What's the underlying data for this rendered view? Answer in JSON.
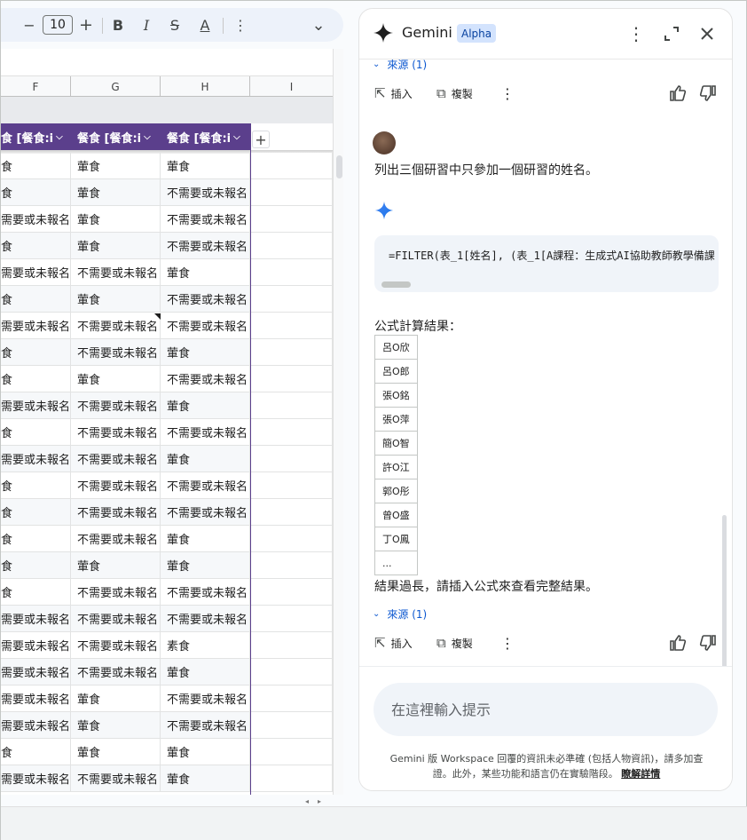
{
  "toolbar": {
    "minus": "−",
    "font_size": "10",
    "plus": "+",
    "bold": "B",
    "italic": "I",
    "strike": "S",
    "text_color": "A",
    "more": "⋮",
    "collapse": "⌄"
  },
  "sheet": {
    "columns": [
      "F",
      "G",
      "H",
      "I"
    ],
    "table_headers": [
      "食 [餐食:i",
      "餐食 [餐食:i",
      "餐食 [餐食:i"
    ],
    "rows": [
      [
        "食",
        "葷食",
        "葷食"
      ],
      [
        "食",
        "葷食",
        "不需要或未報名"
      ],
      [
        "需要或未報名",
        "葷食",
        "不需要或未報名"
      ],
      [
        "食",
        "葷食",
        "不需要或未報名"
      ],
      [
        "需要或未報名",
        "不需要或未報名",
        "葷食"
      ],
      [
        "食",
        "葷食",
        "不需要或未報名"
      ],
      [
        "需要或未報名",
        "不需要或未報名",
        "不需要或未報名"
      ],
      [
        "食",
        "不需要或未報名",
        "葷食"
      ],
      [
        "食",
        "葷食",
        "不需要或未報名"
      ],
      [
        "需要或未報名",
        "不需要或未報名",
        "葷食"
      ],
      [
        "食",
        "不需要或未報名",
        "不需要或未報名"
      ],
      [
        "需要或未報名",
        "不需要或未報名",
        "葷食"
      ],
      [
        "食",
        "不需要或未報名",
        "不需要或未報名"
      ],
      [
        "食",
        "不需要或未報名",
        "不需要或未報名"
      ],
      [
        "食",
        "不需要或未報名",
        "葷食"
      ],
      [
        "食",
        "葷食",
        "葷食"
      ],
      [
        "食",
        "不需要或未報名",
        "不需要或未報名"
      ],
      [
        "需要或未報名",
        "不需要或未報名",
        "不需要或未報名"
      ],
      [
        "需要或未報名",
        "不需要或未報名",
        "素食"
      ],
      [
        "需要或未報名",
        "不需要或未報名",
        "葷食"
      ],
      [
        "需要或未報名",
        "葷食",
        "不需要或未報名"
      ],
      [
        "需要或未報名",
        "葷食",
        "不需要或未報名"
      ],
      [
        "食",
        "葷食",
        "葷食"
      ],
      [
        "需要或未報名",
        "不需要或未報名",
        "葷食"
      ]
    ]
  },
  "gemini": {
    "title": "Gemini",
    "badge": "Alpha",
    "sources_label": "來源 (1)",
    "insert_label": "插入",
    "copy_label": "複製",
    "user_prompt": "列出三個研習中只參加一個研習的姓名。",
    "formula": "=FILTER(表_1[姓名], (表_1[A課程：生成式AI協助教師教學備課",
    "result_label": "公式計算結果：",
    "results": [
      "呂O欣",
      "呂O郎",
      "張O銘",
      "張O萍",
      "簡O智",
      "許O江",
      "郭O彤",
      "曾O盛",
      "丁O鳳",
      "..."
    ],
    "too_long": "結果過長，請插入公式來查看完整結果。",
    "input_placeholder": "在這裡輸入提示",
    "disclaimer": "Gemini 版 Workspace 回覆的資訊未必準確 (包括人物資訊)，請多加查證。此外，某些功能和語言仍在實驗階段。",
    "learn_more": "瞭解詳情"
  },
  "colors": {
    "table_header": "#5b3f8c",
    "gemini_blue": "#0b57d0",
    "badge_bg": "#d3e3fd"
  }
}
